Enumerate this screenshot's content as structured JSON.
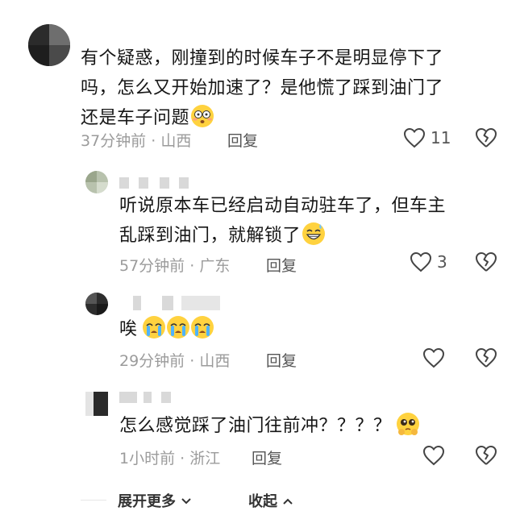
{
  "comments": [
    {
      "lines": [
        "有个疑惑，刚撞到的时候车子不是明显停下了",
        "吗，怎么又开始加速了？是他慌了踩到油门了",
        "还是车子问题"
      ],
      "emoji": "flushed-face-emoji",
      "time": "37分钟前",
      "location": "山西",
      "reply_label": "回复",
      "likes": "11"
    },
    {
      "lines": [
        "听说原本车已经启动自动驻车了，但车主",
        "乱踩到油门，就解锁了"
      ],
      "emoji": "grinning-sweat-emoji",
      "time": "57分钟前",
      "location": "广东",
      "reply_label": "回复",
      "likes": "3"
    },
    {
      "lines": [
        "唉"
      ],
      "emoji": "crying-face-emoji",
      "time": "29分钟前",
      "location": "山西",
      "reply_label": "回复",
      "likes": ""
    },
    {
      "lines": [
        "怎么感觉踩了油门往前冲？？？？"
      ],
      "emoji": "pleading-face-emoji",
      "time": "1小时前",
      "location": "浙江",
      "reply_label": "回复",
      "likes": ""
    }
  ],
  "separator": " · ",
  "footer": {
    "expand_label": "展开更多",
    "collapse_label": "收起"
  }
}
